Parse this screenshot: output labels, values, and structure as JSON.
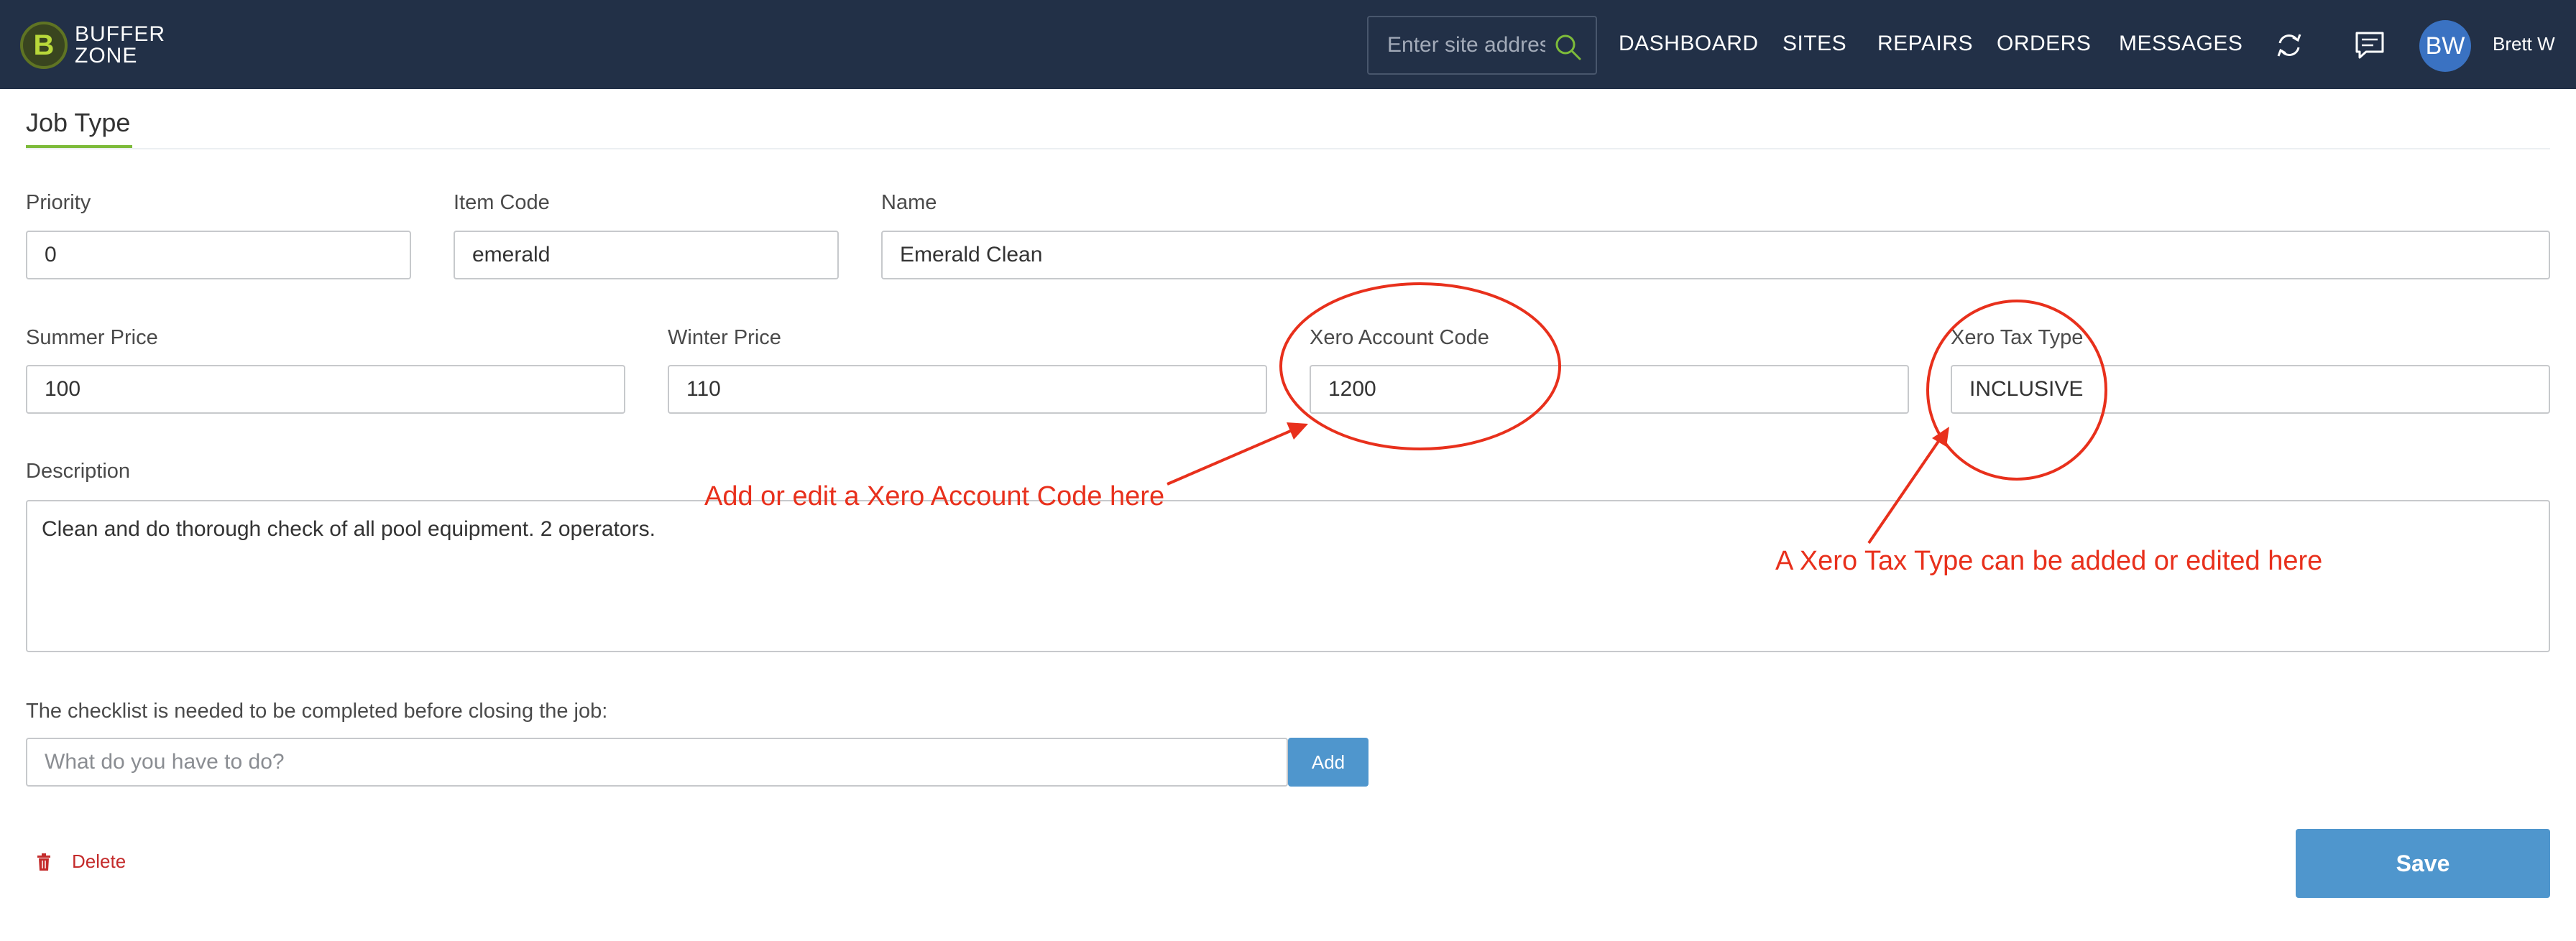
{
  "header": {
    "logo_line1": "BUFFER",
    "logo_line2": "ZONE",
    "search_placeholder": "Enter site address",
    "nav": [
      "DASHBOARD",
      "SITES",
      "REPAIRS",
      "ORDERS",
      "MESSAGES"
    ],
    "avatar_initials": "BW",
    "username": "Brett W"
  },
  "page": {
    "title": "Job Type"
  },
  "form": {
    "priority": {
      "label": "Priority",
      "value": "0"
    },
    "item_code": {
      "label": "Item Code",
      "value": "emerald"
    },
    "name": {
      "label": "Name",
      "value": "Emerald Clean"
    },
    "summer_price": {
      "label": "Summer Price",
      "value": "100"
    },
    "winter_price": {
      "label": "Winter Price",
      "value": "110"
    },
    "xero_account_code": {
      "label": "Xero Account Code",
      "value": "1200"
    },
    "xero_tax_type": {
      "label": "Xero Tax Type",
      "value": "INCLUSIVE"
    },
    "description": {
      "label": "Description",
      "value": "Clean and do thorough check of all pool equipment. 2 operators."
    },
    "checklist": {
      "label": "The checklist is needed to be completed before closing the job:",
      "placeholder": "What do you have to do?",
      "add_label": "Add"
    },
    "delete_label": "Delete",
    "save_label": "Save"
  },
  "annotations": {
    "account_code_note": "Add or edit a Xero Account Code here",
    "tax_type_note": "A Xero Tax Type can be added or edited here"
  },
  "colors": {
    "header_bg": "#223047",
    "accent_green": "#7dbb3a",
    "button_blue": "#4f96cd",
    "delete_red": "#c42b2b",
    "annotation_red": "#e8301c"
  }
}
